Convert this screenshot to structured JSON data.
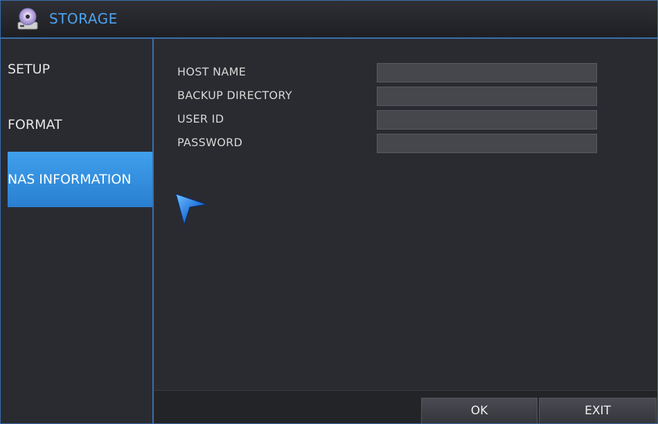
{
  "window": {
    "title": "STORAGE",
    "title_icon": "disc-drive-icon",
    "accent_color": "#3a6fb0",
    "title_color": "#4da3f0"
  },
  "sidebar": {
    "items": [
      {
        "label": "SETUP",
        "active": false
      },
      {
        "label": "FORMAT",
        "active": false
      },
      {
        "label": "NAS INFORMATION",
        "active": true
      }
    ],
    "active_color": "#3fa0ec"
  },
  "form": {
    "fields": [
      {
        "label": "HOST NAME",
        "value": ""
      },
      {
        "label": "BACKUP DIRECTORY",
        "value": ""
      },
      {
        "label": "USER ID",
        "value": ""
      },
      {
        "label": "PASSWORD",
        "value": ""
      }
    ]
  },
  "buttons": {
    "ok_label": "OK",
    "exit_label": "EXIT"
  },
  "cursor": {
    "icon": "mouse-pointer-icon"
  }
}
